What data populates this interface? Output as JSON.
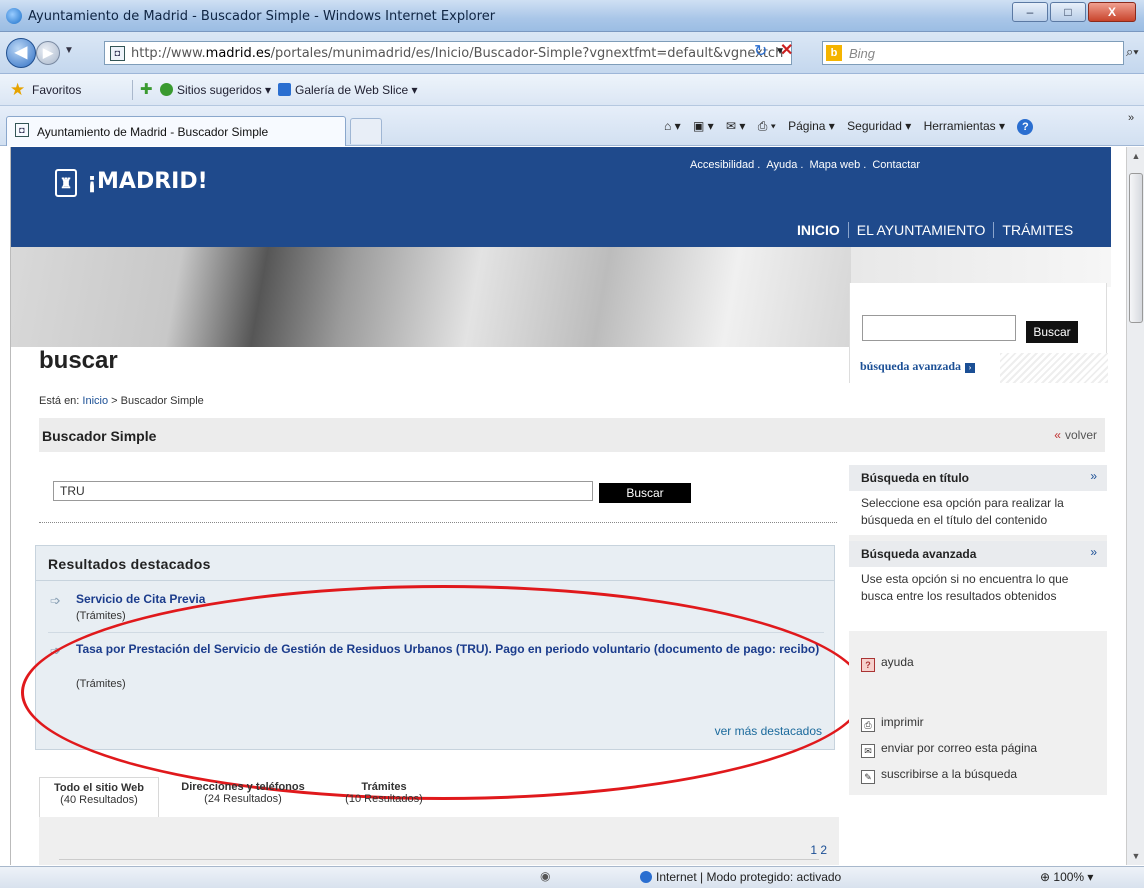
{
  "window": {
    "title": "Ayuntamiento de Madrid - Buscador Simple - Windows Internet Explorer",
    "min": "–",
    "max": "□",
    "close": "X"
  },
  "address": {
    "url_prefix": "http://www.",
    "url_domain": "madrid.es",
    "url_rest": "/portales/munimadrid/es/Inicio/Buscador-Simple?vgnextfmt=default&vgnextch",
    "search_placeholder": "Bing"
  },
  "favorites": {
    "label": "Favoritos",
    "suggested": "Sitios sugeridos ▾",
    "gallery": "Galería de Web Slice ▾"
  },
  "tab": {
    "label": "Ayuntamiento de Madrid - Buscador Simple"
  },
  "commandbar": {
    "home": "⌂ ▾",
    "feeds": "▣ ▾",
    "mail": "✉ ▾",
    "print": "⎙ ▾",
    "page": "Página ▾",
    "security": "Seguridad ▾",
    "tools": "Herramientas ▾",
    "help": "?"
  },
  "site": {
    "logo_text": "¡MADRID!",
    "top_links": [
      "Accesibilidad",
      "Ayuda",
      "Mapa web",
      "Contactar"
    ],
    "nav": [
      "INICIO",
      "EL AYUNTAMIENTO",
      "TRÁMITES"
    ],
    "header_search_button": "Buscar",
    "advanced_search": "búsqueda avanzada",
    "page_heading": "buscar",
    "breadcrumb_prefix": "Está en:",
    "breadcrumb_home": "Inicio",
    "breadcrumb_current": "> Buscador Simple",
    "section_title": "Buscador Simple",
    "back_label": "volver",
    "search_value": "TRU",
    "search_button": "Buscar"
  },
  "featured": {
    "title": "Resultados destacados",
    "results": [
      {
        "title": "Servicio de Cita Previa",
        "category": "(Trámites)"
      },
      {
        "title": "Tasa por Prestación del Servicio de Gestión de Residuos Urbanos (TRU). Pago en periodo voluntario (documento de pago: recibo)",
        "category": "(Trámites)"
      }
    ],
    "more": "ver más destacados"
  },
  "result_tabs": [
    {
      "title": "Todo el sitio Web",
      "count": "(40 Resultados)"
    },
    {
      "title": "Direcciones y teléfonos",
      "count": "(24 Resultados)"
    },
    {
      "title": "Trámites",
      "count": "(10 Resultados)"
    }
  ],
  "pagination": "1 2",
  "sidebar": {
    "title_search": {
      "title": "Búsqueda en título",
      "desc": "Seleccione esa opción para realizar la búsqueda en el título del contenido"
    },
    "advanced_search": {
      "title": "Búsqueda avanzada",
      "desc": "Use esta opción si no encuentra lo que busca entre los resultados obtenidos"
    },
    "help": "ayuda",
    "print": "imprimir",
    "email": "enviar por correo esta página",
    "subscribe": "suscribirse a la búsqueda"
  },
  "status": {
    "zone": "Internet | Modo protegido: activado",
    "zoom": "100%"
  }
}
